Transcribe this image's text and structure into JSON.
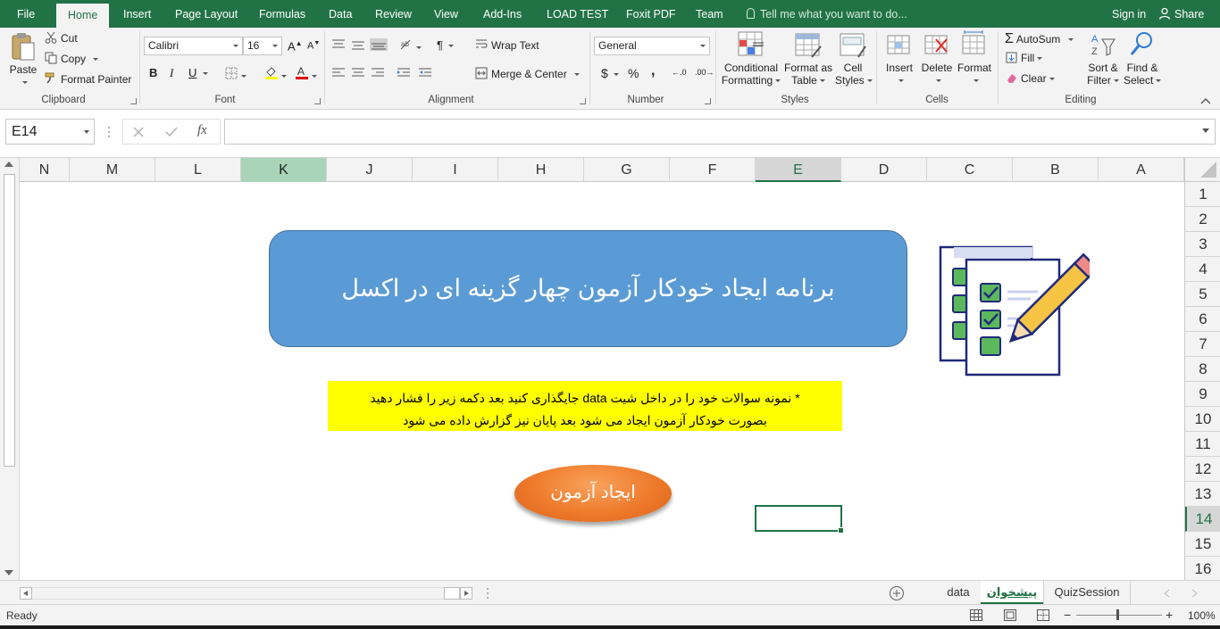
{
  "ribbon_tabs": [
    "File",
    "Home",
    "Insert",
    "Page Layout",
    "Formulas",
    "Data",
    "Review",
    "View",
    "Add-Ins",
    "LOAD TEST",
    "Foxit PDF",
    "Team"
  ],
  "active_tab": "Home",
  "tell_me": "Tell me what you want to do...",
  "account": {
    "sign_in": "Sign in",
    "share": "Share"
  },
  "clipboard": {
    "paste": "Paste",
    "cut": "Cut",
    "copy": "Copy",
    "format_painter": "Format Painter",
    "label": "Clipboard"
  },
  "font": {
    "name": "Calibri",
    "size": "16",
    "bold": "B",
    "italic": "I",
    "underline": "U",
    "label": "Font"
  },
  "alignment": {
    "wrap_text": "Wrap Text",
    "merge_center": "Merge & Center",
    "label": "Alignment"
  },
  "number": {
    "format": "General",
    "currency": "$",
    "percent": "%",
    "comma": ",",
    "label": "Number"
  },
  "styles": {
    "conditional": [
      "Conditional",
      "Formatting"
    ],
    "format_table": [
      "Format as",
      "Table"
    ],
    "cell_styles": [
      "Cell",
      "Styles"
    ],
    "label": "Styles"
  },
  "cells": {
    "insert": "Insert",
    "delete": "Delete",
    "format": "Format",
    "label": "Cells"
  },
  "editing": {
    "autosum": "AutoSum",
    "fill": "Fill",
    "clear": "Clear",
    "sort_filter": [
      "Sort &",
      "Filter"
    ],
    "find_select": [
      "Find &",
      "Select"
    ],
    "label": "Editing"
  },
  "formula_bar": {
    "name_box": "E14",
    "fx": "fx",
    "value": ""
  },
  "columns": [
    "N",
    "M",
    "L",
    "K",
    "J",
    "I",
    "H",
    "G",
    "F",
    "E",
    "D",
    "C",
    "B",
    "A"
  ],
  "rows": [
    "1",
    "2",
    "3",
    "4",
    "5",
    "6",
    "7",
    "8",
    "9",
    "10",
    "11",
    "12",
    "13",
    "14",
    "15",
    "16"
  ],
  "selected_cell": "E14",
  "sheet_content": {
    "title": "برنامه ایجاد خودکار آزمون چهار گزینه ای در اکسل",
    "note_line1": "* نمونه سوالات خود را در داخل شیت data جایگذاری کنید بعد دکمه زیر را فشار دهید",
    "note_line2": "بصورت خودکار آزمون ایجاد می شود بعد پایان نیز گزارش داده می شود",
    "start_button": "ایجاد آزمون"
  },
  "sheet_tabs": [
    "data",
    "پیشخوان",
    "QuizSession"
  ],
  "active_sheet": "پیشخوان",
  "status": {
    "ready": "Ready",
    "zoom": "100%"
  },
  "colors": {
    "excel_green": "#217346",
    "title_fill": "#5b9bd5",
    "note_fill": "#ffff00",
    "button_fill": "#ef7a2b"
  }
}
